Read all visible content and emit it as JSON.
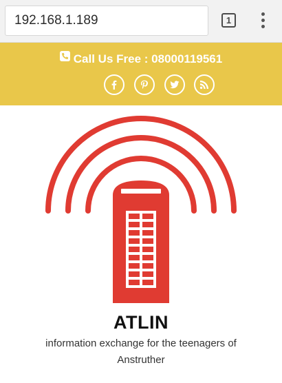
{
  "browser": {
    "url": "192.168.1.189",
    "tab_count": "1"
  },
  "header": {
    "call_text": "Call Us Free : 08000119561",
    "call_icon": "phone-icon",
    "socials": [
      {
        "name": "facebook-icon",
        "glyph": "f"
      },
      {
        "name": "pinterest-icon",
        "glyph": "p"
      },
      {
        "name": "twitter-icon",
        "glyph": "bird"
      },
      {
        "name": "rss-icon",
        "glyph": "rss"
      }
    ],
    "bg_color": "#e9c74a"
  },
  "brand": {
    "logo": "red-phone-box-logo",
    "title": "ATLIN",
    "tagline": "information exchange for the teenagers of Anstruther",
    "logo_color": "#e03b32"
  }
}
